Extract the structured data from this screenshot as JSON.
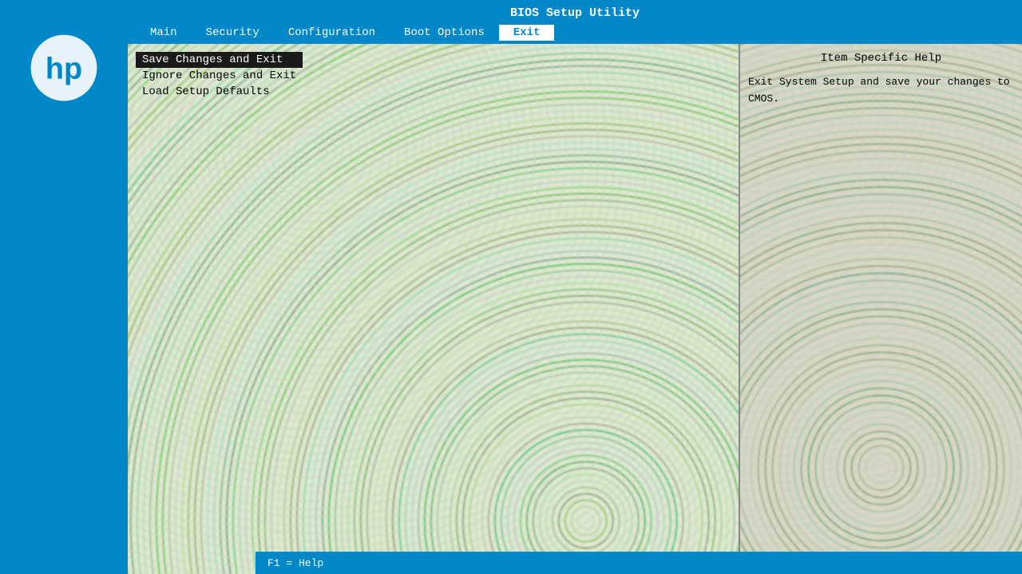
{
  "title": "BIOS Setup Utility",
  "nav": {
    "items": [
      {
        "label": "Main",
        "active": false
      },
      {
        "label": "Security",
        "active": false
      },
      {
        "label": "Configuration",
        "active": false
      },
      {
        "label": "Boot Options",
        "active": false
      },
      {
        "label": "Exit",
        "active": true
      }
    ]
  },
  "menu": {
    "items": [
      {
        "label": "Save Changes and Exit",
        "selected": true
      },
      {
        "label": "Ignore Changes and Exit",
        "selected": false
      },
      {
        "label": "Load Setup Defaults",
        "selected": false
      }
    ]
  },
  "help": {
    "title": "Item Specific Help",
    "text": "Exit System Setup and save your changes to CMOS."
  },
  "bottom": {
    "label": "F1 = Help"
  },
  "colors": {
    "blue": "#0087c8",
    "bg_light": "#e8e8d0",
    "bg_right": "#d4d3c0"
  }
}
